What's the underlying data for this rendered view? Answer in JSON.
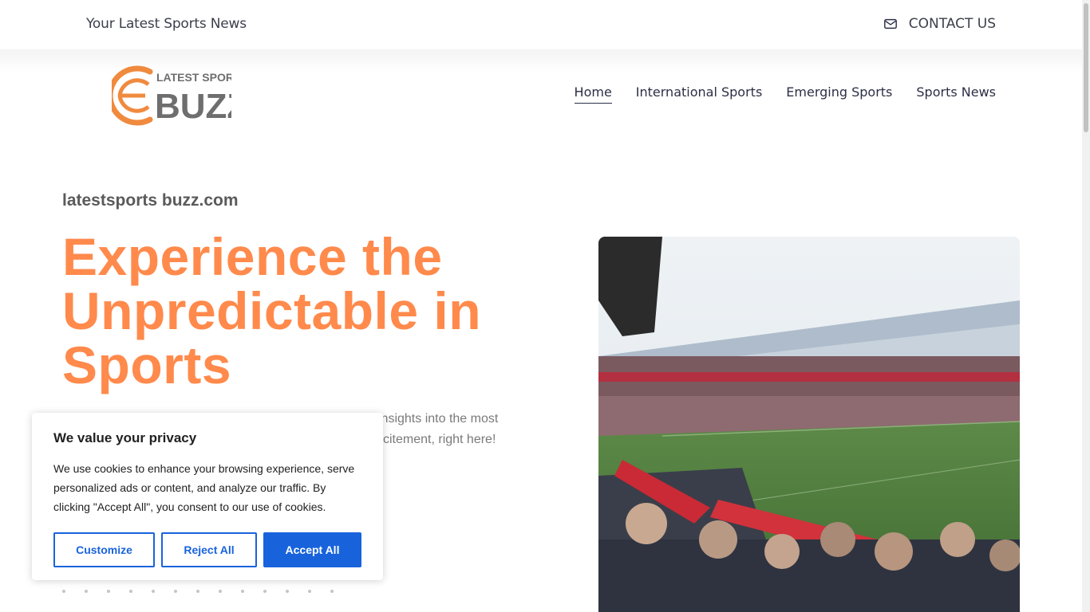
{
  "topbar": {
    "tagline": "Your Latest Sports News",
    "contact_label": "CONTACT US",
    "contact_icon": "envelope-icon"
  },
  "logo": {
    "line1": "LATEST SPORTS",
    "line2": "BUZZ"
  },
  "nav": {
    "items": [
      {
        "label": "Home",
        "active": true
      },
      {
        "label": "International Sports"
      },
      {
        "label": "Emerging Sports"
      },
      {
        "label": "Sports News"
      }
    ]
  },
  "hero": {
    "subtitle": "latestsports buzz.com",
    "headline_lines": [
      "Experience the",
      "Unpredictable in",
      "Sports"
    ],
    "lede_line1": "insights into the most",
    "lede_line2": "citement, right here!"
  },
  "cookie_banner": {
    "title": "We value your privacy",
    "body": "We use cookies to enhance your browsing experience, serve personalized ads or content, and analyze our traffic. By clicking \"Accept All\", you consent to our use of cookies.",
    "customize_label": "Customize",
    "reject_label": "Reject All",
    "accept_label": "Accept All"
  },
  "colors": {
    "accent_orange": "#ff8a4c",
    "cookie_blue": "#1863dc",
    "nav_text": "#2b2f45"
  }
}
